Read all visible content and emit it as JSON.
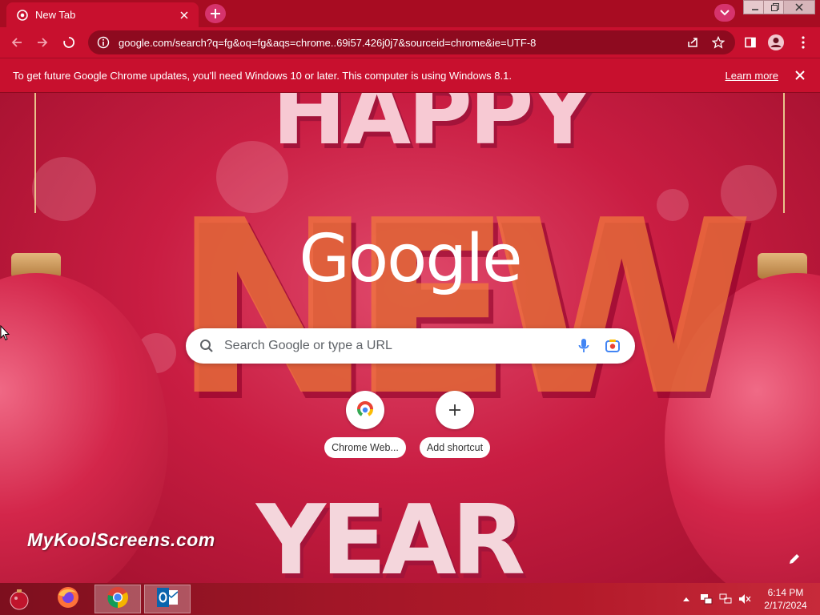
{
  "tab": {
    "title": "New Tab"
  },
  "window_controls": {
    "minimize": "—",
    "maximize": "❐",
    "close": "✕"
  },
  "omnibox": {
    "url": "google.com/search?q=fg&oq=fg&aqs=chrome..69i57.426j0j7&sourceid=chrome&ie=UTF-8"
  },
  "infobar": {
    "message": "To get future Google Chrome updates, you'll need Windows 10 or later. This computer is using Windows 8.1.",
    "link": "Learn more"
  },
  "ntp": {
    "logo": "Google",
    "search_placeholder": "Search Google or type a URL",
    "shortcuts": [
      {
        "label": "Chrome Web...",
        "icon": "chrome-web-store-icon"
      },
      {
        "label": "Add shortcut",
        "icon": "plus-icon"
      }
    ],
    "background_text": {
      "top": "HAPPY",
      "middle": "NEW",
      "bottom": "YEAR"
    },
    "credit": "",
    "watermark": "MyKoolScreens.com"
  },
  "taskbar": {
    "apps": [
      "firefox-icon",
      "chrome-icon",
      "outlook-icon"
    ],
    "clock": {
      "time": "6:14 PM",
      "date": "2/17/2024"
    }
  },
  "colors": {
    "frame": "#a80c22",
    "toolbar": "#c8102e",
    "omnibox": "#8e0a1f",
    "accent_pink": "#d6336c"
  }
}
